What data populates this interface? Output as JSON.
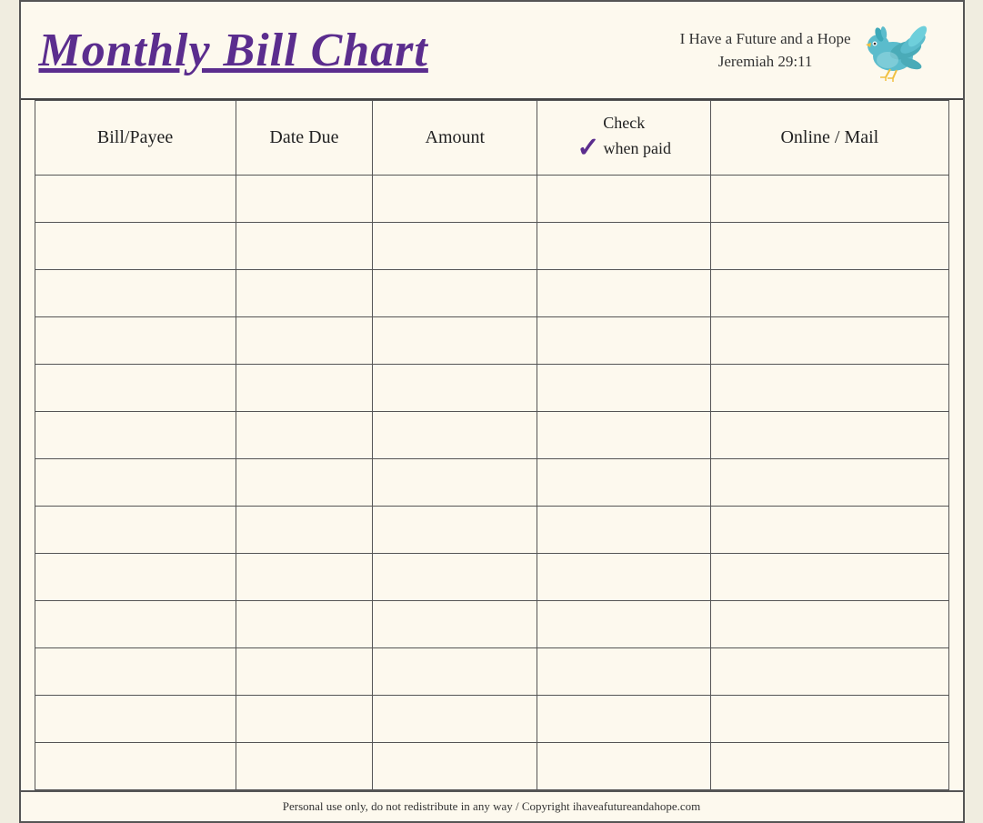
{
  "header": {
    "title": "Monthly Bill Chart",
    "scripture_line1": "I Have a Future and a Hope",
    "scripture_line2": "Jeremiah 29:11"
  },
  "table": {
    "columns": [
      {
        "key": "bill",
        "label": "Bill/Payee"
      },
      {
        "key": "date",
        "label": "Date Due"
      },
      {
        "key": "amount",
        "label": "Amount"
      },
      {
        "key": "check",
        "label": "when paid",
        "check_symbol": "✓",
        "check_prefix": "Check"
      },
      {
        "key": "online",
        "label": "Online / Mail"
      }
    ],
    "row_count": 13
  },
  "footer": {
    "text": "Personal use only, do not redistribute in any way / Copyright ihaveafutureandahope.com"
  }
}
